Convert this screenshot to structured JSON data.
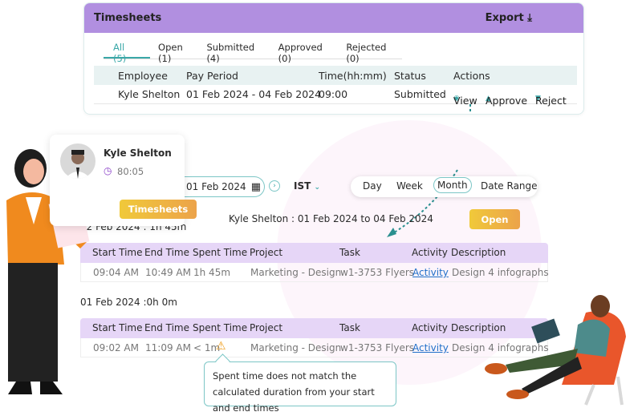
{
  "timesheets_card": {
    "title": "Timesheets",
    "export_label": "Export",
    "tabs": [
      {
        "label": "All (5)",
        "active": true
      },
      {
        "label": "Open (1)"
      },
      {
        "label": "Submitted (4)"
      },
      {
        "label": "Approved (0)"
      },
      {
        "label": "Rejected (0)"
      }
    ],
    "columns": [
      "Employee",
      "Pay Period",
      "Time(hh:mm)",
      "Status",
      "Actions"
    ],
    "row": {
      "employee": "Kyle Shelton",
      "pay_period": "01 Feb 2024 - 04 Feb 2024",
      "time": "09:00",
      "status": "Submitted",
      "actions": [
        "View",
        "Approve",
        "Reject"
      ]
    }
  },
  "profile": {
    "name": "Kyle Shelton",
    "hours": "80:05",
    "button": "Timesheets"
  },
  "toolbar": {
    "date": "01 Feb 2024",
    "timezone": "IST",
    "views": [
      "Day",
      "Week",
      "Month",
      "Date Range"
    ],
    "selected_view": "Month"
  },
  "summary": {
    "title": "Kyle Shelton : 01 Feb 2024 to 04 Feb 2024",
    "status_button": "Open"
  },
  "detail_columns": [
    "Start Time",
    "End Time",
    "Spent Time",
    "Project",
    "Task",
    "Activity",
    "Description"
  ],
  "days": [
    {
      "label": "02 Feb 2024 : 1h 45m",
      "row": [
        "09:04 AM",
        "10:49 AM",
        "1h 45m",
        "Marketing - Design",
        "w1-3753 Flyers",
        "Activity",
        "Design 4 infographs"
      ]
    },
    {
      "label": "01 Feb 2024 :0h 0m",
      "row": [
        "09:02 AM",
        "11:09 AM",
        "< 1m",
        "Marketing - Design",
        "w1-3753 Flyers",
        "Activity",
        "Design 4 infographs"
      ],
      "warning": true
    }
  ],
  "tooltip": "Spent time does not match the calculated duration from your start and end times",
  "colors": {
    "header_purple": "#b18fe0",
    "table_purple": "#e6d6f7",
    "teal": "#3aa8a8",
    "warning": "#f0a020"
  }
}
